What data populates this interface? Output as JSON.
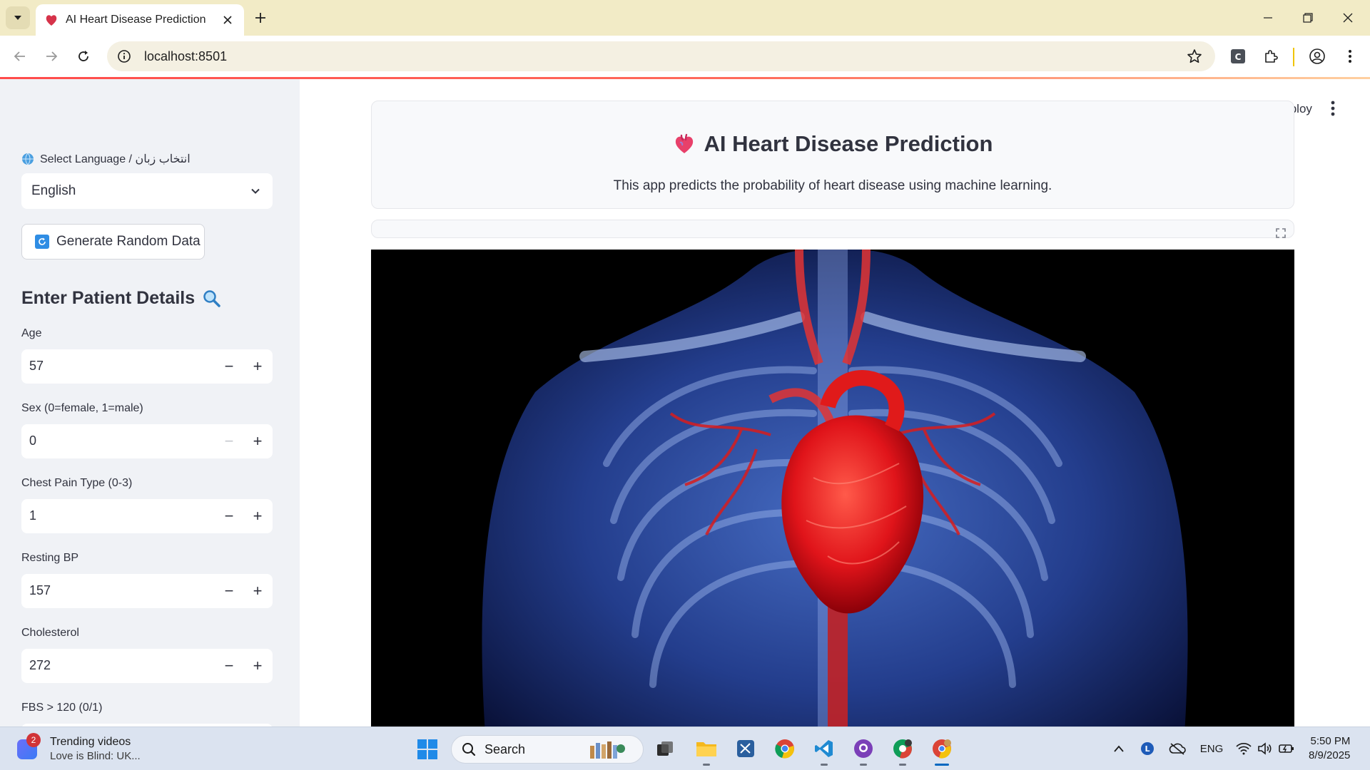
{
  "browser": {
    "tab_title": "AI Heart Disease Prediction",
    "url": "localhost:8501"
  },
  "sidebar": {
    "language_label": "Select Language / انتخاب زبان",
    "language_value": "English",
    "generate_button": "Generate Random Data",
    "heading": "Enter Patient Details",
    "fields": [
      {
        "label": "Age",
        "value": "57"
      },
      {
        "label": "Sex (0=female, 1=male)",
        "value": "0"
      },
      {
        "label": "Chest Pain Type (0-3)",
        "value": "1"
      },
      {
        "label": "Resting BP",
        "value": "157"
      },
      {
        "label": "Cholesterol",
        "value": "272"
      },
      {
        "label": "FBS > 120 (0/1)",
        "value": ""
      }
    ]
  },
  "main": {
    "deploy_label": "Deploy",
    "title": "AI Heart Disease Prediction",
    "subtitle": "This app predicts the probability of heart disease using machine learning."
  },
  "taskbar": {
    "widget_badge": "2",
    "widget_title": "Trending videos",
    "widget_subtitle": "Love is Blind: UK...",
    "search_placeholder": "Search",
    "language": "ENG",
    "time": "5:50 PM",
    "date": "8/9/2025"
  },
  "colors": {
    "accent": "#ff4b4b",
    "sidebar_bg": "#f0f2f6",
    "tabbar_bg": "#f2ebc6",
    "taskbar_bg": "#dbe3f0"
  }
}
